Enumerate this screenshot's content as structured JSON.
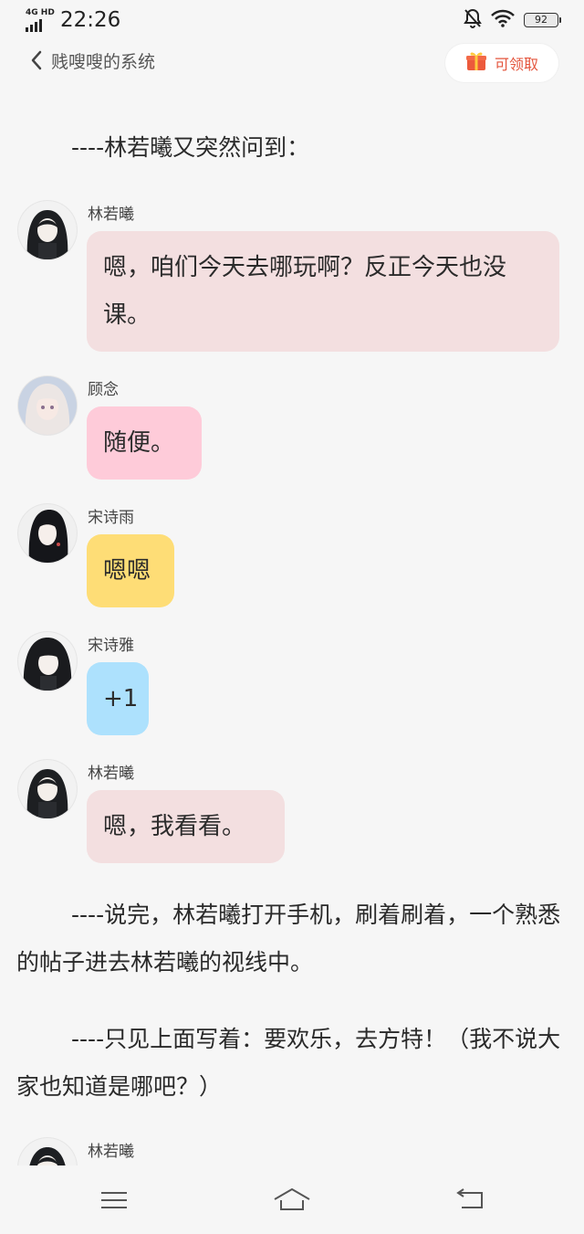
{
  "status_bar": {
    "network": "4G HD",
    "time": "22:26",
    "battery": "92",
    "icons": [
      "signal-icon",
      "bell-off-icon",
      "wifi-icon",
      "battery-icon"
    ]
  },
  "header": {
    "back_icon": "chevron-left-icon",
    "title": "贱嗖嗖的系统",
    "reward_icon": "gift-icon",
    "reward_label": "可领取"
  },
  "content": {
    "narration1": "----林若曦又突然问到：",
    "messages": [
      {
        "sender": "林若曦",
        "text": "嗯，咱们今天去哪玩啊？反正今天也没课。"
      },
      {
        "sender": "顾念",
        "text": "随便。"
      },
      {
        "sender": "宋诗雨",
        "text": "嗯嗯"
      },
      {
        "sender": "宋诗雅",
        "text": "+1"
      },
      {
        "sender": "林若曦",
        "text": "嗯，我看看。"
      }
    ],
    "narration2": "----说完，林若曦打开手机，刷着刷着，一个熟悉的帖子进去林若曦的视线中。",
    "narration3": "----只见上面写着：要欢乐，去方特！（我不说大家也知道是哪吧？）",
    "last_sender": "林若曦"
  },
  "colors": {
    "background": "#f6f6f6",
    "bubble_lin": "#f3dfe0",
    "bubble_gu": "#fecbd9",
    "bubble_shiyu": "#fedd76",
    "bubble_shiya": "#ade1fd",
    "reward_accent": "#e4553d"
  },
  "nav_bar": {
    "icons": [
      "menu-icon",
      "home-icon",
      "back-icon"
    ]
  }
}
